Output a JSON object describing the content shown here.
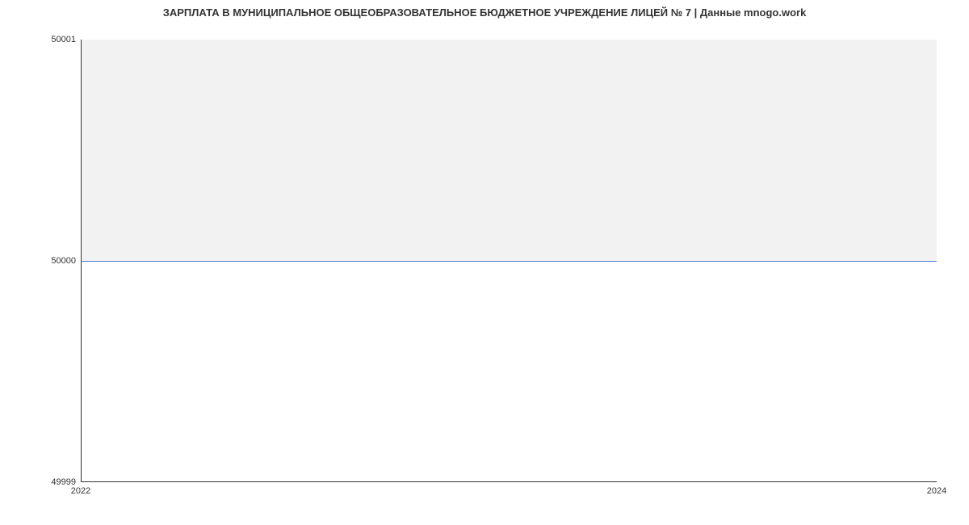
{
  "chart_data": {
    "type": "area",
    "title": "ЗАРПЛАТА В МУНИЦИПАЛЬНОЕ ОБЩЕОБРАЗОВАТЕЛЬНОЕ БЮДЖЕТНОЕ УЧРЕЖДЕНИЕ ЛИЦЕЙ № 7 | Данные mnogo.work",
    "x": [
      2022,
      2024
    ],
    "values": [
      50000,
      50000
    ],
    "xlabel": "",
    "ylabel": "",
    "ylim": [
      49999,
      50001
    ],
    "xlim": [
      2022,
      2024
    ],
    "y_ticks": [
      "49999",
      "50000",
      "50001"
    ],
    "x_ticks": [
      "2022",
      "2024"
    ]
  }
}
